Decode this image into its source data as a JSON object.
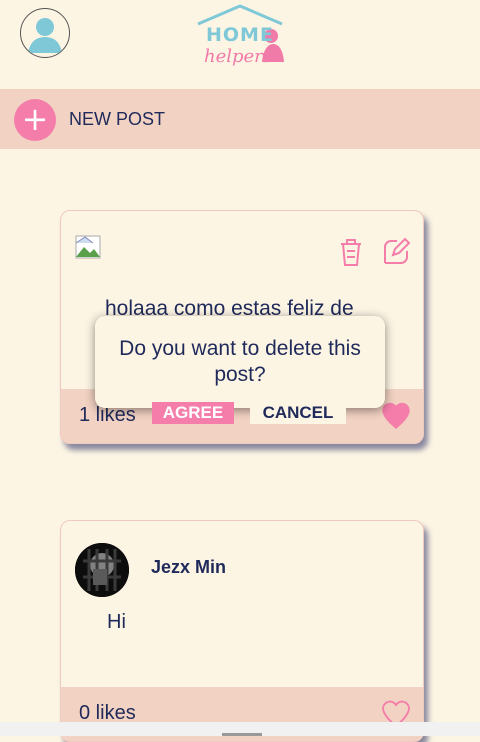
{
  "header": {
    "logo_top": "HOME",
    "logo_bottom": "helpers"
  },
  "new_post": {
    "label": "NEW POST",
    "plus_symbol": "+"
  },
  "posts": [
    {
      "text": "holaaa como estas feliz de",
      "likes": "1 likes",
      "liked": true
    },
    {
      "author": "Jezx Min",
      "text": "Hi",
      "likes": "0 likes",
      "liked": false
    }
  ],
  "dialog": {
    "message": "Do you want to delete this post?",
    "agree_label": "AGREE",
    "cancel_label": "CANCEL"
  },
  "icons": {
    "profile": "user-icon",
    "delete": "trash-icon",
    "edit": "edit-icon",
    "like": "heart-icon",
    "broken_image": "broken-image-icon"
  },
  "colors": {
    "background": "#fdf5e4",
    "bar": "#f2d2c2",
    "accent": "#f57daa",
    "text": "#1f2a5a",
    "logo_blue": "#7ec8d8"
  }
}
